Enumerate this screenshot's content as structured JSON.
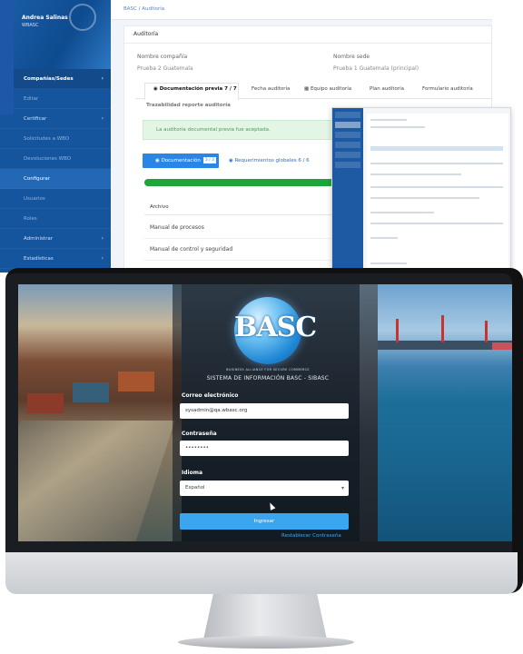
{
  "app": {
    "sidebar": {
      "user_name": "Andrea Salinas",
      "user_org": "WBASC",
      "items": [
        {
          "label": "Compañías/Sedes",
          "style": "head"
        },
        {
          "label": "Editar",
          "style": "dim"
        },
        {
          "label": "Certificar",
          "style": "normal"
        },
        {
          "label": "Solicitudes a WBO",
          "style": "dim"
        },
        {
          "label": "Devoluciones WBO",
          "style": "dim"
        },
        {
          "label": "Configurar",
          "style": "active"
        },
        {
          "label": "Usuarios",
          "style": "dim"
        },
        {
          "label": "Roles",
          "style": "dim"
        },
        {
          "label": "Administrar",
          "style": "normal"
        },
        {
          "label": "Estadísticas",
          "style": "normal"
        }
      ]
    },
    "breadcrumb": "BASC / Auditoría",
    "card_title": "Auditoría",
    "company_label": "Nombre compañía",
    "company_value": "Prueba 2 Guatemala",
    "site_label": "Nombre sede",
    "site_value": "Prueba 1 Guatemala (principal)",
    "tabs": [
      {
        "label": "Documentación previa  7 / 7",
        "active": true
      },
      {
        "label": "Fecha auditoría",
        "active": false
      },
      {
        "label": "Equipo auditoría",
        "active": false
      },
      {
        "label": "Plan auditoría",
        "active": false
      },
      {
        "label": "Formulario auditoría",
        "active": false
      }
    ],
    "subtab": "Trazabilidad reporte auditoría",
    "alert": "La auditoría documental previa fue aceptada.",
    "docs_button": "Documentación",
    "docs_badge": "3 / 3",
    "req_button": "Requerimientos globales  6 / 6",
    "progress_percent": 100,
    "table_header": "Archivo",
    "rows": [
      "Manual de procesos",
      "Manual de control y seguridad"
    ]
  },
  "login": {
    "logo": "BASC",
    "logo_tagline": "BUSINESS ALLIANCE FOR SECURE COMMERCE",
    "system_title": "SISTEMA DE INFORMACIÓN BASC - SIBASC",
    "email_label": "Correo electrónico",
    "email_value": "sysadmin@qa.wbasc.org",
    "password_label": "Contraseña",
    "password_value": "••••••••",
    "language_label": "Idioma",
    "language_value": "Español",
    "submit_label": "Ingresar",
    "reset_link": "Restablecer Contraseña"
  },
  "colors": {
    "sidebar": "#15559e",
    "primary_button": "#2a86e6",
    "success": "#20a43c",
    "login_button": "#39a6ef"
  }
}
